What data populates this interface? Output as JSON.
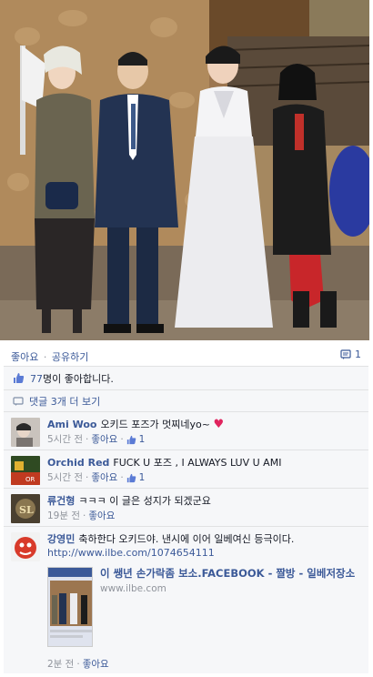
{
  "actions": {
    "like": "좋아요",
    "dot": "·",
    "share": "공유하기",
    "comment_count": "1"
  },
  "likes": {
    "count": "77",
    "text": "명이 좋아합니다."
  },
  "more_comments": "댓글 3개 더 보기",
  "comments": [
    {
      "author": "Ami Woo",
      "text": "오키드 포즈가 멋찌네yo~",
      "time": "5시간 전",
      "like": "좋아요",
      "likes": "1",
      "avatar_color": "#c9c3bd"
    },
    {
      "author": "Orchid Red",
      "text": "FUCK U 포즈 , I ALWAYS LUV U AMI",
      "time": "5시간 전",
      "like": "좋아요",
      "likes": "1",
      "avatar_color": "#3a5a2a"
    },
    {
      "author": "류건형",
      "text": "ㅋㅋㅋ 이 글은 성지가 되겠군요",
      "time": "19분 전",
      "like": "좋아요",
      "avatar_color": "#4a4030",
      "avatar_text": "SL"
    },
    {
      "author": "강영민",
      "text": "축하한다 오키드야. 낸시에 이어 일베여신 등극이다.",
      "link": "http://www.ilbe.com/1074654111",
      "share_title": "이 쌩년 손가락좀 보소.FACEBOOK - 짤방 - 일베저장소",
      "share_domain": "www.ilbe.com",
      "time": "2분 전",
      "like": "좋아요",
      "avatar_color": "#d83a2a"
    }
  ],
  "colors": {
    "link": "#3b5998",
    "meta": "#90949c",
    "panel": "#f6f7f9",
    "heart": "#e0245e"
  }
}
